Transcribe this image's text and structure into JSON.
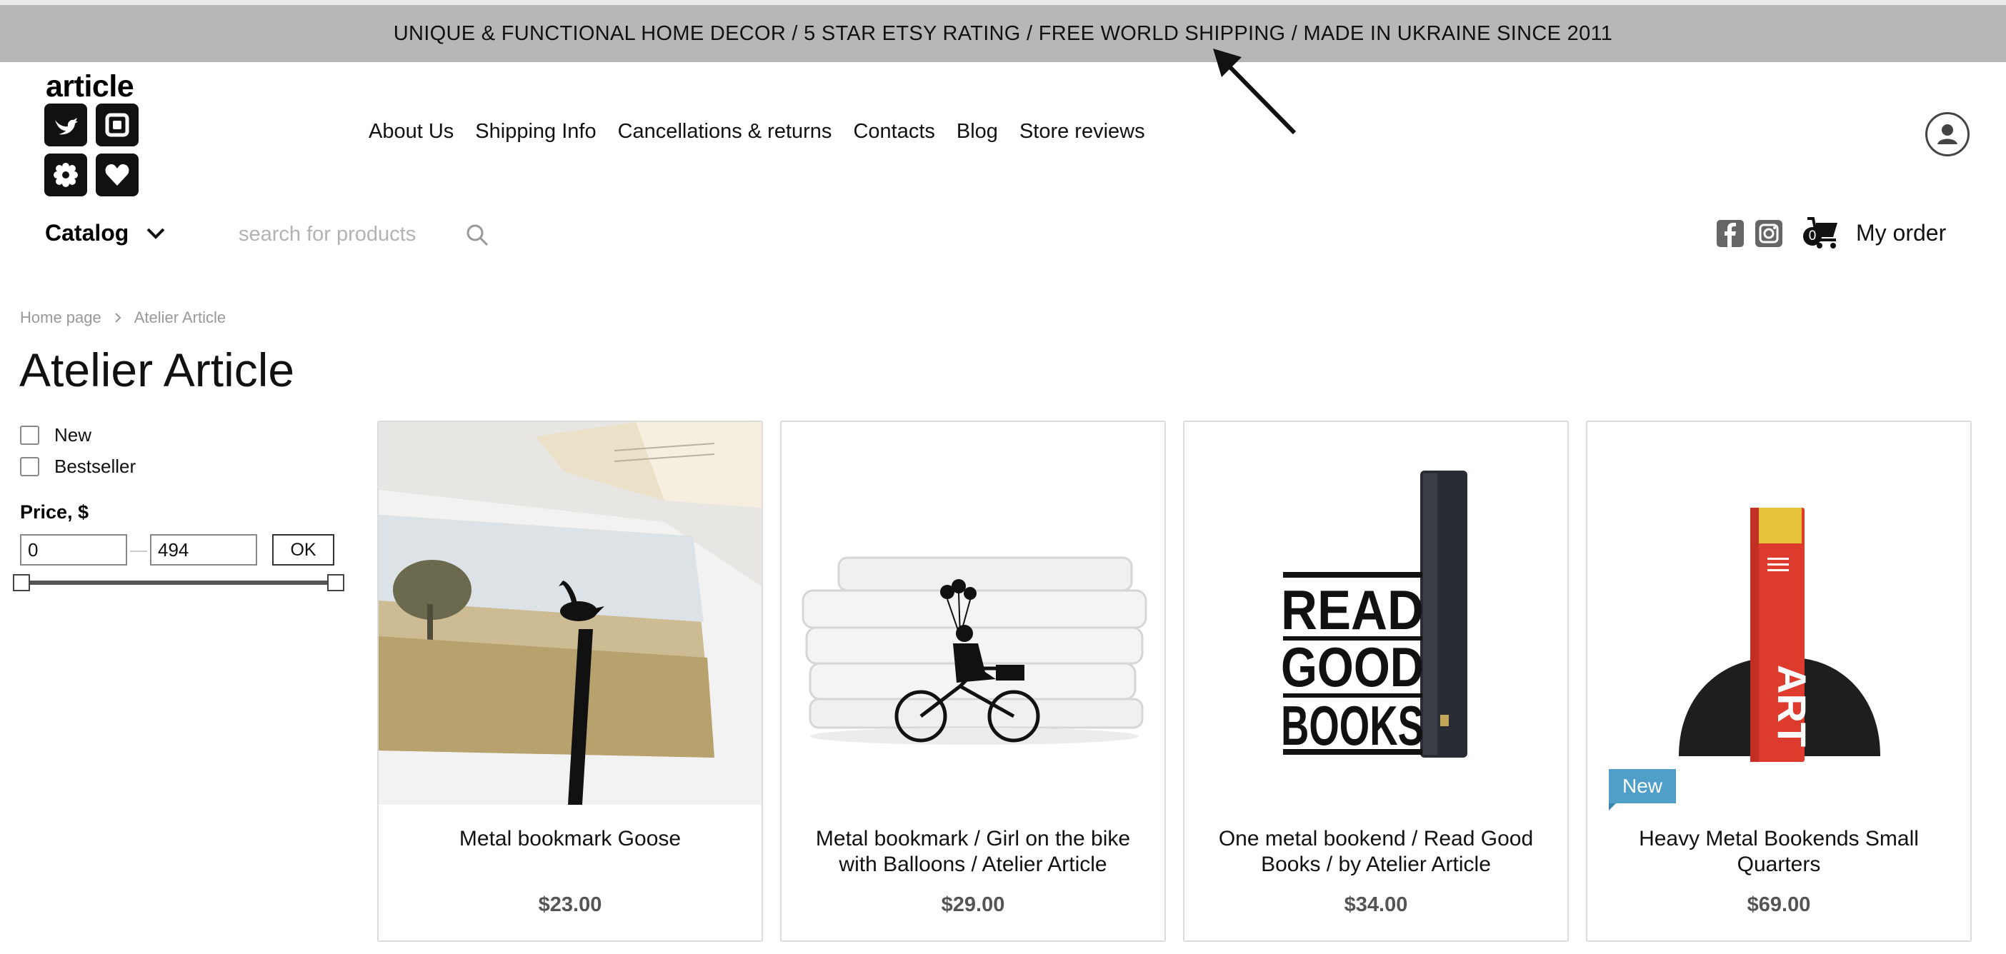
{
  "banner": {
    "text": "UNIQUE & FUNCTIONAL HOME DECOR / 5 STAR ETSY RATING / FREE WORLD SHIPPING / MADE IN UKRAINE SINCE 2011"
  },
  "logo": {
    "word": "article",
    "icons": [
      "bird-icon",
      "square-icon",
      "flower-icon",
      "heart-icon"
    ]
  },
  "nav": {
    "items": [
      "About Us",
      "Shipping Info",
      "Cancellations & returns",
      "Contacts",
      "Blog",
      "Store reviews"
    ]
  },
  "catalog": {
    "label": "Catalog"
  },
  "search": {
    "placeholder": "search for products",
    "value": ""
  },
  "social": {
    "icons": [
      "facebook-icon",
      "instagram-icon"
    ]
  },
  "order": {
    "cart_count": "0",
    "label": "My order"
  },
  "breadcrumb": {
    "home": "Home page",
    "current": "Atelier Article"
  },
  "page": {
    "title": "Atelier Article"
  },
  "filters": {
    "new_label": "New",
    "bestseller_label": "Bestseller",
    "price_title": "Price, $",
    "price_min": "0",
    "price_max": "494",
    "ok_label": "OK"
  },
  "products": [
    {
      "name": "Metal bookmark Goose",
      "price": "$23.00",
      "badge": ""
    },
    {
      "name": "Metal bookmark / Girl on the bike with Balloons / Atelier Article",
      "price": "$29.00",
      "badge": ""
    },
    {
      "name": "One metal bookend / Read Good Books / by Atelier Article",
      "price": "$34.00",
      "badge": ""
    },
    {
      "name": "Heavy Metal Bookends Small Quarters",
      "price": "$69.00",
      "badge": "New"
    }
  ],
  "colors": {
    "banner_bg": "#b7b7b7",
    "badge_bg": "#4f9fc9",
    "price_text": "#555555"
  }
}
